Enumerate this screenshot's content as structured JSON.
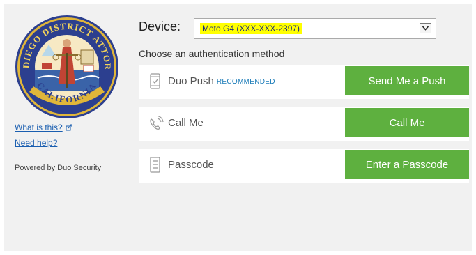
{
  "sidebar": {
    "logo_icon": "san-diego-district-attorney-seal",
    "logo_text_top": "SAN DIEGO DISTRICT ATTORNEY",
    "logo_text_bottom": "CALIFORNIA",
    "what_is_this": "What is this?",
    "need_help": "Need help?",
    "powered_by": "Powered by Duo Security"
  },
  "device": {
    "label": "Device:",
    "selected": "Moto G4 (XXX-XXX-2397)",
    "highlight_color": "#ffff00"
  },
  "auth": {
    "heading": "Choose an authentication method",
    "methods": [
      {
        "label": "Duo Push",
        "badge": "RECOMMENDED",
        "button": "Send Me a Push",
        "icon": "phone-check-icon"
      },
      {
        "label": "Call Me",
        "badge": "",
        "button": "Call Me",
        "icon": "phone-call-icon"
      },
      {
        "label": "Passcode",
        "badge": "",
        "button": "Enter a Passcode",
        "icon": "passcode-icon"
      }
    ]
  },
  "colors": {
    "button_green": "#5eb03f",
    "link_blue": "#1a5eb0",
    "panel_bg": "#f1f1f1"
  }
}
